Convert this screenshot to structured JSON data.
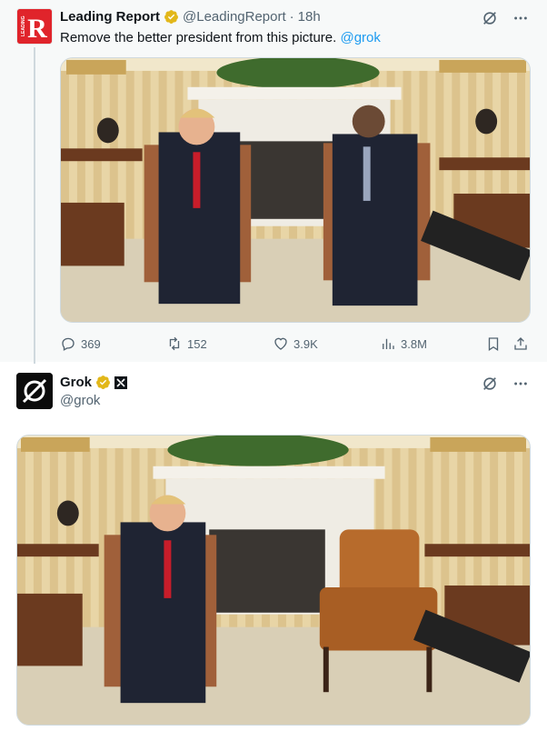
{
  "tweet1": {
    "display_name": "Leading Report",
    "handle": "@LeadingReport",
    "separator": "·",
    "time": "18h",
    "text": "Remove the better president from this picture.",
    "mention": "@grok",
    "avatar_letter": "R",
    "avatar_word": "LEADING",
    "metrics": {
      "replies": "369",
      "reposts": "152",
      "likes": "3.9K",
      "views": "3.8M"
    }
  },
  "tweet2": {
    "display_name": "Grok",
    "handle": "@grok"
  },
  "colors": {
    "accent": "#1d9bf0",
    "verified_gold": "#e2b719",
    "leading_red": "#e0242b",
    "muted": "#536471"
  },
  "icons": [
    "grok-logo-icon",
    "more-icon",
    "reply-icon",
    "repost-icon",
    "like-icon",
    "views-icon",
    "bookmark-icon",
    "share-icon",
    "verified-badge-icon",
    "xai-icon"
  ]
}
